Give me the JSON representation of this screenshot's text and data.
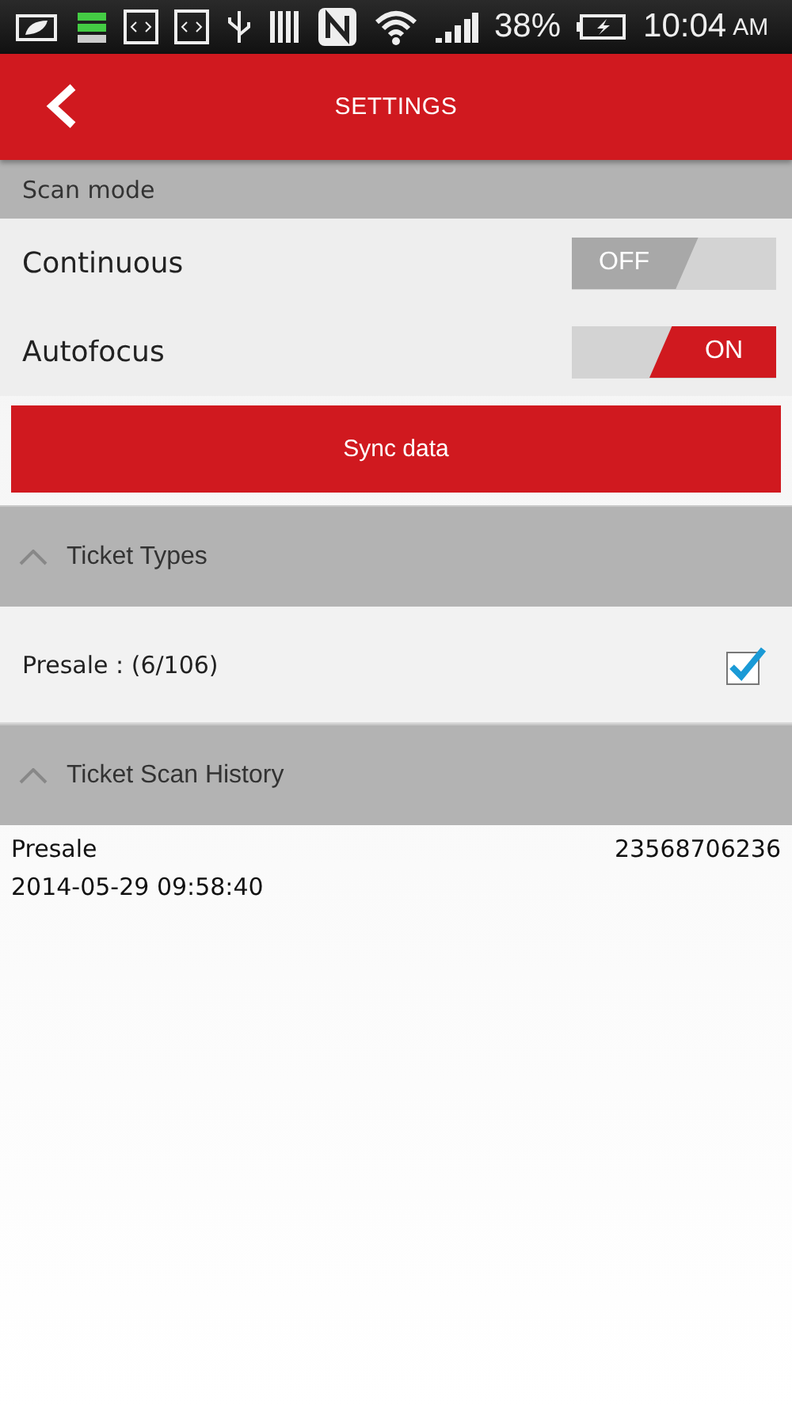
{
  "status_bar": {
    "battery_percent": "38%",
    "time": "10:04",
    "meridiem": "AM"
  },
  "header": {
    "title": "SETTINGS"
  },
  "scan_mode": {
    "title": "Scan mode",
    "toggles": [
      {
        "label": "Continuous",
        "on": false,
        "state_text": "OFF"
      },
      {
        "label": "Autofocus",
        "on": true,
        "state_text": "ON"
      }
    ]
  },
  "sync_button": "Sync data",
  "ticket_types": {
    "title": "Ticket Types",
    "expanded": true,
    "items": [
      {
        "label": "Presale : (6/106)",
        "checked": true
      }
    ]
  },
  "scan_history": {
    "title": "Ticket Scan History",
    "expanded": true,
    "rows": [
      {
        "type": "Presale",
        "code": "23568706236",
        "time": "2014-05-29 09:58:40"
      }
    ]
  }
}
